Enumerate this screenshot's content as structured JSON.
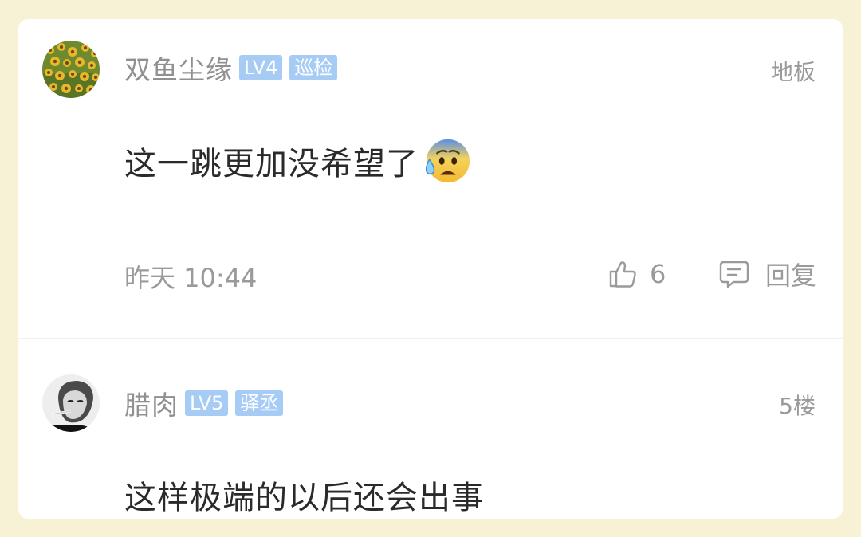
{
  "comments": [
    {
      "username": "双鱼尘缘",
      "level_badge": "LV4",
      "role_badge": "巡检",
      "floor": "地板",
      "text": "这一跳更加没希望了",
      "emoji_icon": "anxious-face-with-sweat-icon",
      "time": "昨天 10:44",
      "likes": "6",
      "reply_label": "回复",
      "avatar_icon": "sunflower-field-avatar"
    },
    {
      "username": "腊肉",
      "level_badge": "LV5",
      "role_badge": "驿丞",
      "floor": "5楼",
      "text": "这样极端的以后还会出事",
      "avatar_icon": "man-portrait-avatar"
    }
  ],
  "colors": {
    "page_background": "#f7f2d5",
    "badge_background": "#a6ccf5",
    "muted_text": "#909090",
    "body_text": "#2a2a2a"
  }
}
